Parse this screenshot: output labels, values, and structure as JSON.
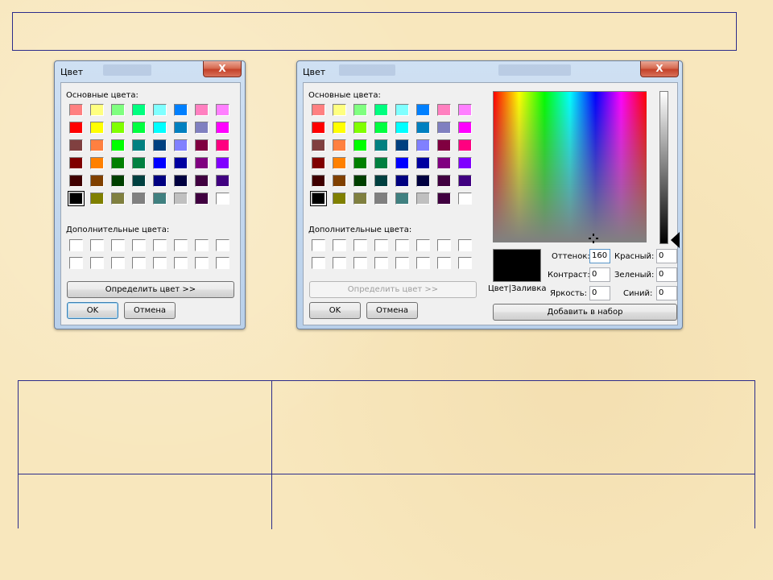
{
  "dialog_small": {
    "title": "Цвет",
    "close_label": "X",
    "basic_colors_label": "Основные цвета:",
    "custom_colors_label": "Дополнительные цвета:",
    "define_button": "Определить цвет >>",
    "ok_button": "OK",
    "cancel_button": "Отмена"
  },
  "dialog_full": {
    "title": "Цвет",
    "close_label": "X",
    "basic_colors_label": "Основные цвета:",
    "custom_colors_label": "Дополнительные цвета:",
    "define_button": "Определить цвет >>",
    "ok_button": "OK",
    "cancel_button": "Отмена",
    "preview_label": "Цвет|Заливка",
    "add_button": "Добавить в набор",
    "hue_label": "Оттенок:",
    "hue_value": "160",
    "sat_label": "Контраст:",
    "sat_value": "0",
    "lum_label": "Яркость:",
    "lum_value": "0",
    "red_label": "Красный:",
    "red_value": "0",
    "green_label": "Зеленый:",
    "green_value": "0",
    "blue_label": "Синий:",
    "blue_value": "0"
  },
  "colors": {
    "basic": [
      [
        "#ff8080",
        "#ffff80",
        "#80ff80",
        "#00ff80",
        "#80ffff",
        "#0080ff",
        "#ff80c0",
        "#ff80ff"
      ],
      [
        "#ff0000",
        "#ffff00",
        "#80ff00",
        "#00ff40",
        "#00ffff",
        "#0080c0",
        "#8080c0",
        "#ff00ff"
      ],
      [
        "#804040",
        "#ff8040",
        "#00ff00",
        "#008080",
        "#004080",
        "#8080ff",
        "#800040",
        "#ff0080"
      ],
      [
        "#800000",
        "#ff8000",
        "#008000",
        "#008040",
        "#0000ff",
        "#0000a0",
        "#800080",
        "#8000ff"
      ],
      [
        "#400000",
        "#804000",
        "#004000",
        "#004040",
        "#000080",
        "#000040",
        "#400040",
        "#400080"
      ],
      [
        "#000000",
        "#808000",
        "#808040",
        "#808080",
        "#408080",
        "#c0c0c0",
        "#400040",
        "#ffffff"
      ]
    ],
    "custom_default": "#ffffff",
    "selected": "#000000"
  }
}
